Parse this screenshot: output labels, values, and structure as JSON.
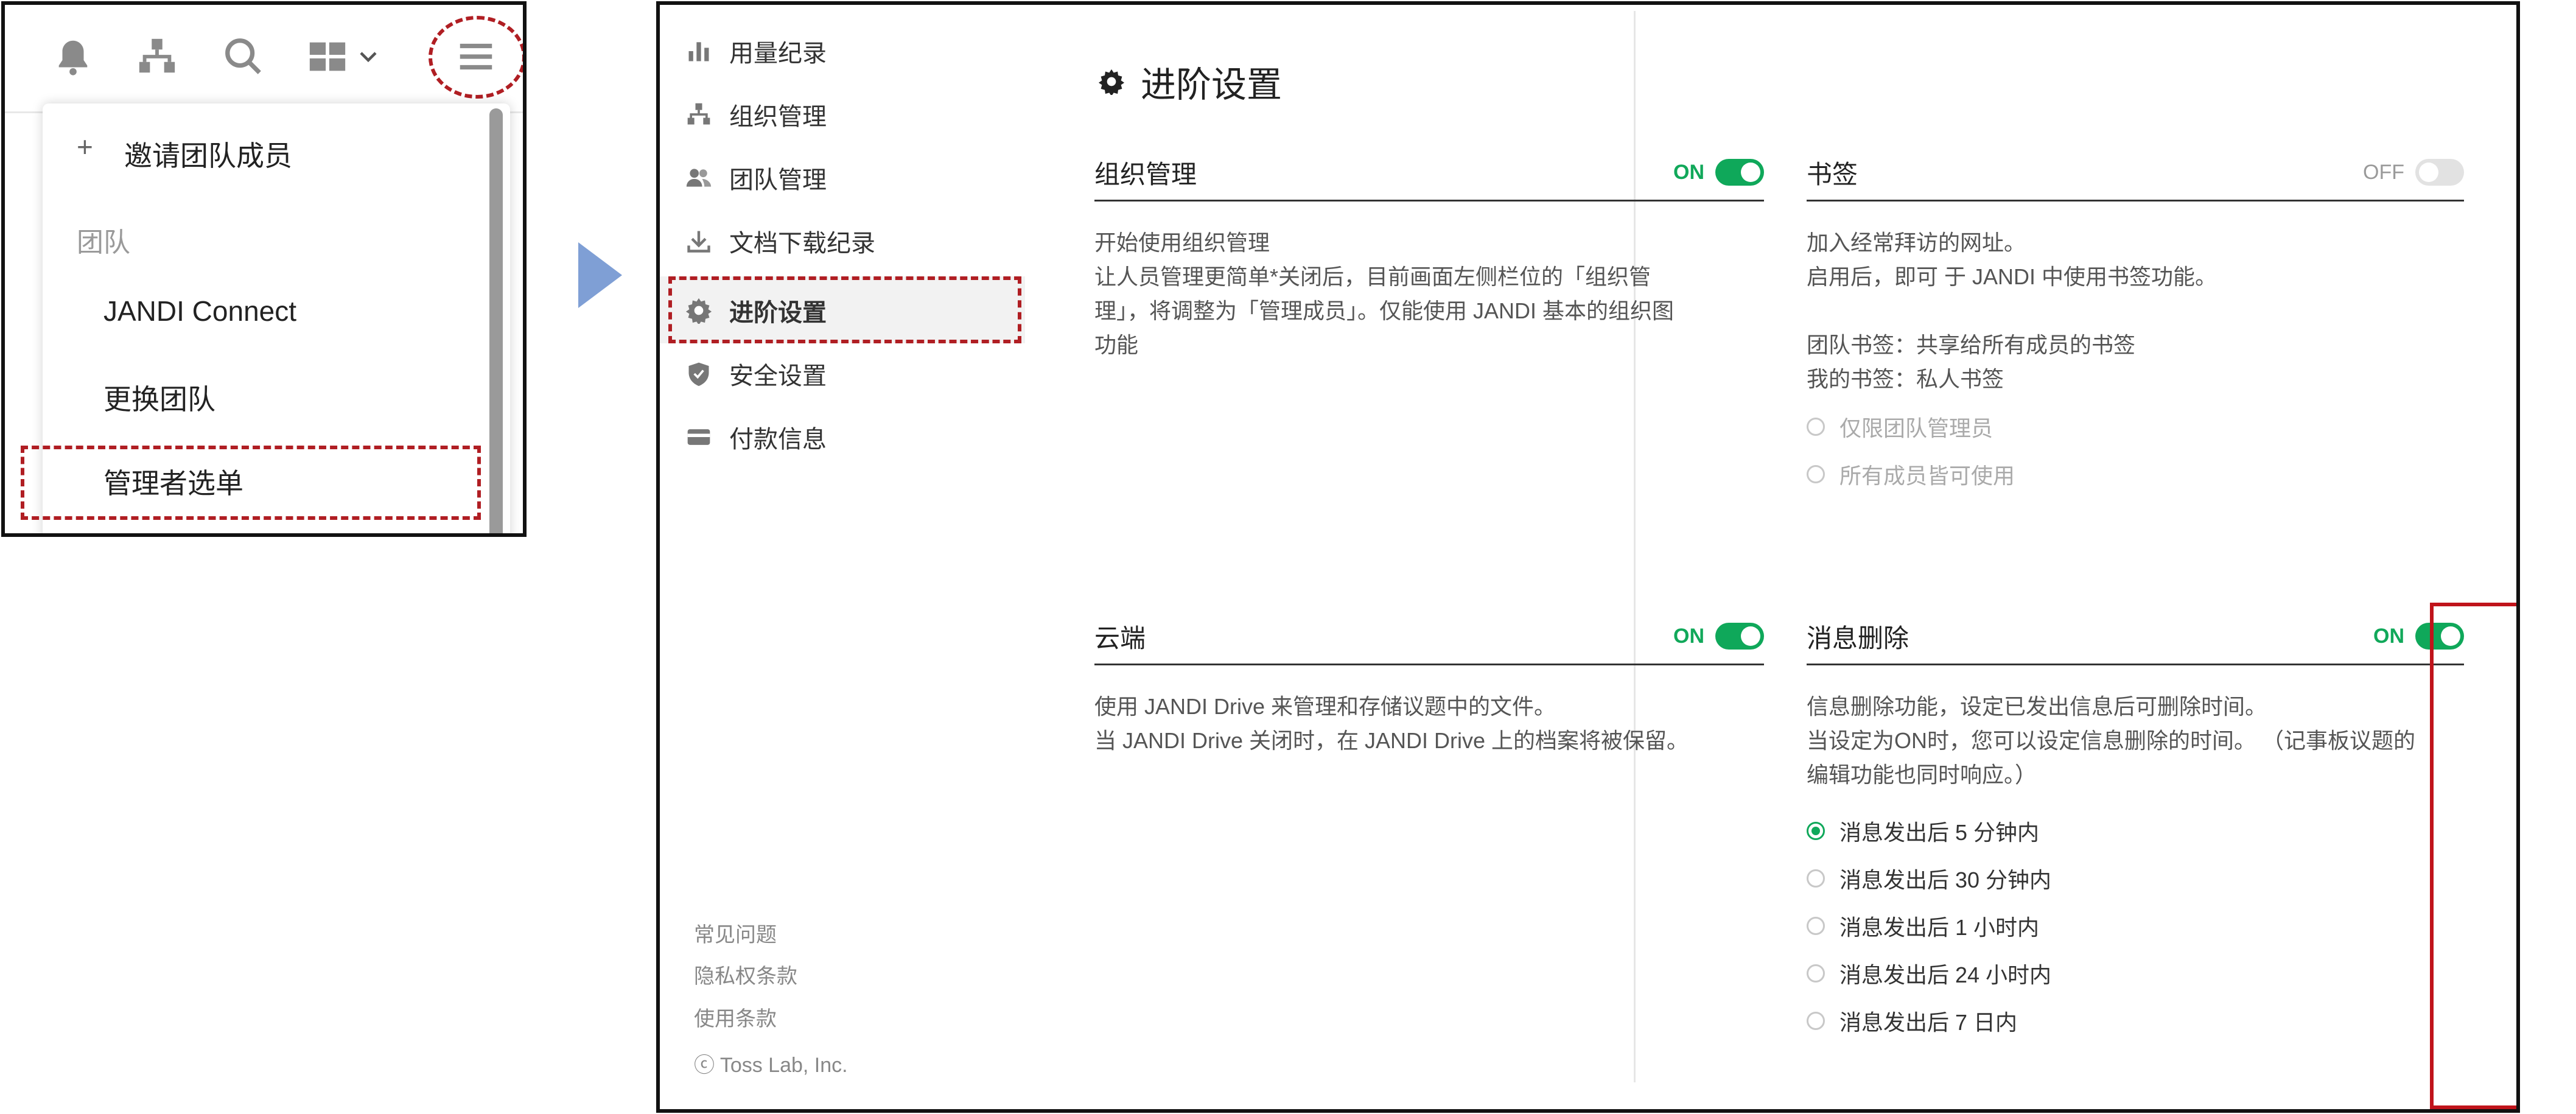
{
  "menu_panel": {
    "topbar_icons": [
      "bell-icon",
      "org-chart-icon",
      "search-icon",
      "apps-grid-icon",
      "chevron-down-icon",
      "hamburger-icon"
    ],
    "invite_plus": "+",
    "invite_label": "邀请团队成员",
    "section_label": "团队",
    "items": [
      "JANDI Connect",
      "更换团队",
      "管理者选单"
    ]
  },
  "sidebar": {
    "items": [
      {
        "label": "用量纪录",
        "icon": "bar-chart-icon"
      },
      {
        "label": "组织管理",
        "icon": "org-chart-icon"
      },
      {
        "label": "团队管理",
        "icon": "people-icon"
      },
      {
        "label": "文档下载纪录",
        "icon": "download-icon"
      },
      {
        "label": "进阶设置",
        "icon": "gear-icon"
      },
      {
        "label": "安全设置",
        "icon": "shield-icon"
      },
      {
        "label": "付款信息",
        "icon": "card-icon"
      }
    ],
    "footer": [
      "常见问题",
      "隐私权条款",
      "使用条款",
      "ⓒ Toss Lab, Inc."
    ]
  },
  "main": {
    "title": "进阶设置",
    "sections": {
      "org": {
        "title": "组织管理",
        "toggle": "ON",
        "lines": [
          "开始使用组织管理",
          "让人员管理更简单*关闭后，目前画面左侧栏位的「组织管",
          "理」，将调整为「管理成员」。仅能使用 JANDI 基本的组织图",
          "功能"
        ]
      },
      "bookmark": {
        "title": "书签",
        "toggle": "OFF",
        "lines": [
          "加入经常拜访的网址。",
          "启用后，即可 于 JANDI 中使用书签功能。",
          "",
          "团队书签：共享给所有成员的书签",
          "我的书签：私人书签"
        ],
        "options": [
          "仅限团队管理员",
          "所有成员皆可使用"
        ]
      },
      "cloud": {
        "title": "云端",
        "toggle": "ON",
        "lines": [
          "使用 JANDI Drive 来管理和存储议题中的文件。",
          "当 JANDI Drive 关闭时，在 JANDI Drive 上的档案将被保留。"
        ]
      },
      "msgdel": {
        "title": "消息删除",
        "toggle": "ON",
        "lines": [
          "信息删除功能，设定已发出信息后可删除时间。",
          "当设定为ON时，您可以设定信息删除的时间。 （记事板议题的",
          "编辑功能也同时响应。）"
        ],
        "options": [
          "消息发出后 5 分钟内",
          "消息发出后 30 分钟内",
          "消息发出后 1 小时内",
          "消息发出后 24 小时内",
          "消息发出后 7 日内"
        ],
        "selected": "消息发出后 5 分钟内"
      }
    }
  },
  "colors": {
    "accent_green": "#0fa85a",
    "highlight_red": "#b01e23",
    "arrow_blue": "#7f9fd5"
  }
}
